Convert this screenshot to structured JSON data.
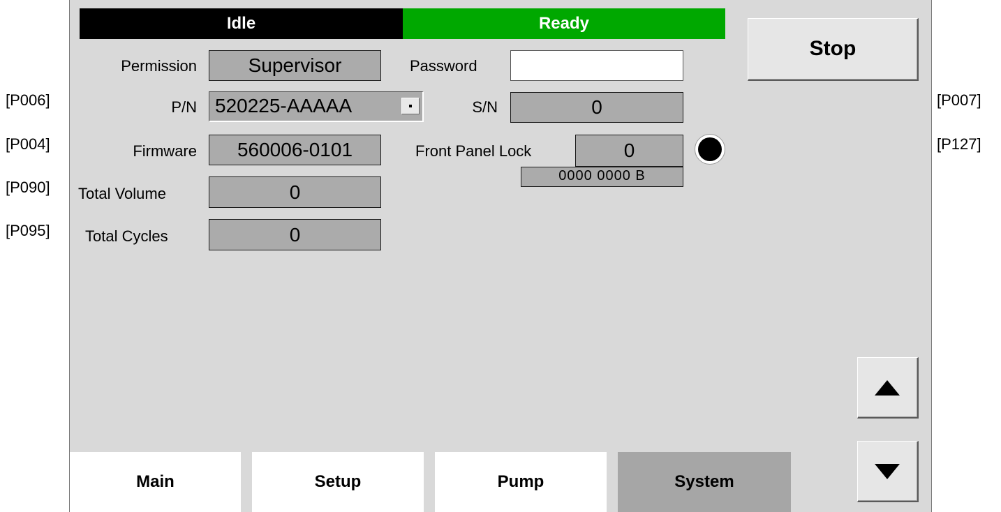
{
  "side_labels": {
    "left": [
      "[P006]",
      "[P004]",
      "[P090]",
      "[P095]"
    ],
    "right": [
      "[P007]",
      "[P127]"
    ]
  },
  "status": {
    "left": "Idle",
    "right": "Ready",
    "left_color": "#000000",
    "right_color": "#00a800"
  },
  "stop_button": "Stop",
  "permission": {
    "label": "Permission",
    "value": "Supervisor"
  },
  "password": {
    "label": "Password",
    "value": ""
  },
  "pn": {
    "label": "P/N",
    "value": "520225-AAAAA"
  },
  "sn": {
    "label": "S/N",
    "value": "0"
  },
  "firmware": {
    "label": "Firmware",
    "value": "560006-0101"
  },
  "front_panel_lock": {
    "label": "Front Panel Lock",
    "value": "0",
    "binary": "0000  0000  B"
  },
  "total_volume": {
    "label": "Total Volume",
    "value": "0"
  },
  "total_cycles": {
    "label": "Total Cycles",
    "value": "0"
  },
  "indicator": {
    "icon": "status-indicator-icon",
    "state": "off"
  },
  "scroll": {
    "up_icon": "arrow-up-icon",
    "down_icon": "arrow-down-icon"
  },
  "tabs": [
    {
      "label": "Main",
      "active": false
    },
    {
      "label": "Setup",
      "active": false
    },
    {
      "label": "Pump",
      "active": false
    },
    {
      "label": "System",
      "active": true
    }
  ]
}
